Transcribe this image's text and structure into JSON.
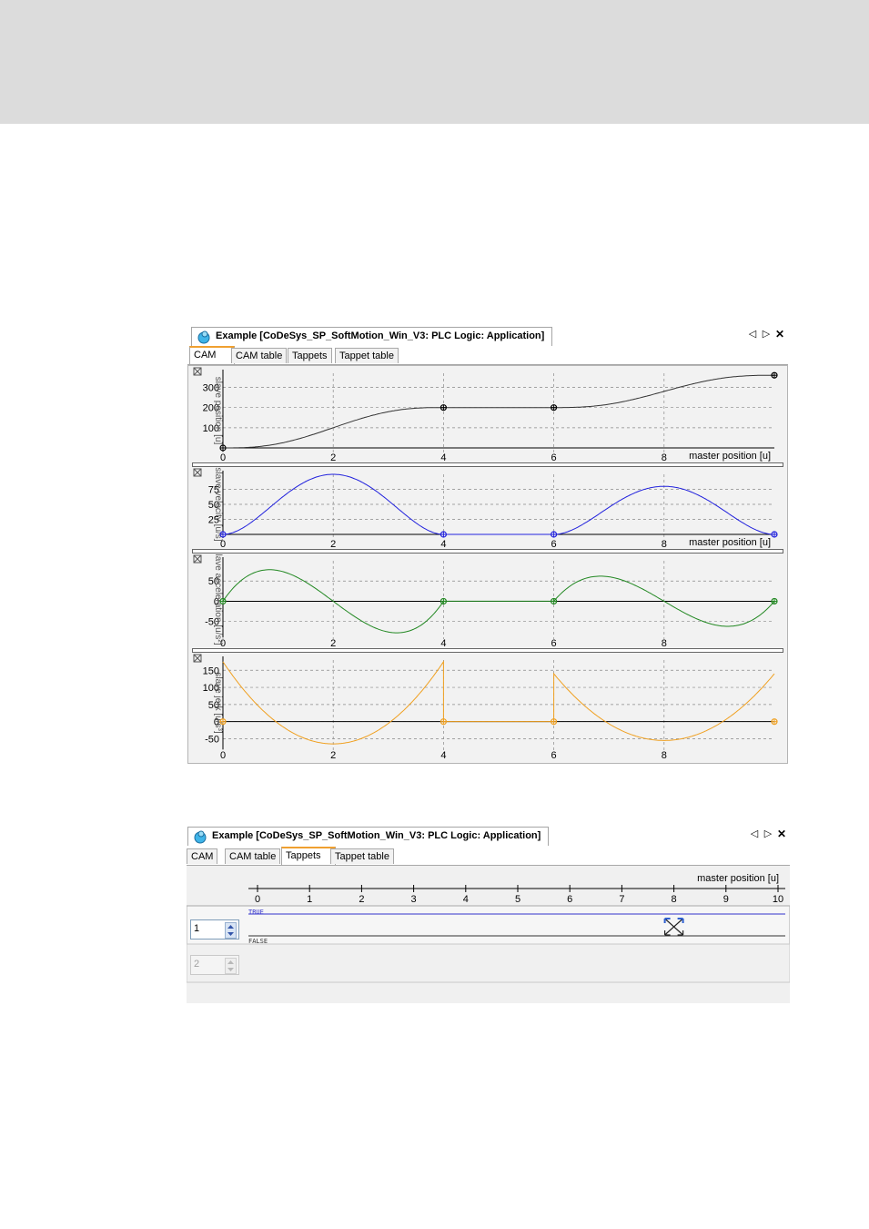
{
  "window1": {
    "title": "Example [CoDeSys_SP_SoftMotion_Win_V3: PLC Logic: Application]",
    "tabs": [
      "CAM",
      "CAM table",
      "Tappets",
      "Tappet table"
    ],
    "active_tab": "CAM",
    "controls": {
      "left": "◁",
      "right": "▷",
      "close": "✕"
    }
  },
  "window2": {
    "title": "Example [CoDeSys_SP_SoftMotion_Win_V3: PLC Logic: Application]",
    "tabs": [
      "CAM",
      "CAM table",
      "Tappets",
      "Tappet table"
    ],
    "active_tab": "Tappets",
    "controls": {
      "left": "◁",
      "right": "▷",
      "close": "✕"
    },
    "axis_label": "master position [u]",
    "axis_ticks": [
      "0",
      "1",
      "2",
      "3",
      "4",
      "5",
      "6",
      "7",
      "8",
      "9",
      "10"
    ],
    "true_label": "TRUE",
    "false_label": "FALSE",
    "tappet_1": "1",
    "tappet_2": "2",
    "colors": {
      "true_line": "#3333cc",
      "marker": "#3060d0"
    }
  },
  "chart_data": [
    {
      "type": "line",
      "ylabel": "slave position [u]",
      "xlabel": "master position [u]",
      "xlim": [
        0,
        10
      ],
      "ylim": [
        0,
        370
      ],
      "x_ticks": [
        "0",
        "2",
        "4",
        "6",
        "8"
      ],
      "y_ticks": [
        "100",
        "200",
        "300"
      ],
      "color": "#333333",
      "series": [
        {
          "x": [
            0,
            4,
            6,
            10
          ],
          "y": [
            0,
            200,
            200,
            360
          ]
        }
      ]
    },
    {
      "type": "line",
      "ylabel": "slave velocity [u/s]",
      "xlabel": "master position [u]",
      "xlim": [
        0,
        10
      ],
      "ylim": [
        0,
        100
      ],
      "x_ticks": [
        "0",
        "2",
        "4",
        "6",
        "8"
      ],
      "y_ticks": [
        "25",
        "50",
        "75"
      ],
      "color": "#2222dd",
      "series": [
        {
          "x": [
            0,
            2,
            4,
            6,
            8,
            10
          ],
          "y": [
            0,
            100,
            0,
            0,
            80,
            0
          ]
        }
      ]
    },
    {
      "type": "line",
      "ylabel": "slave acceleration [u/s²]",
      "xlim": [
        0,
        10
      ],
      "ylim": [
        -80,
        100
      ],
      "x_ticks": [
        "0",
        "2",
        "4",
        "6",
        "8"
      ],
      "y_ticks": [
        "-50",
        "0",
        "50"
      ],
      "color": "#228822",
      "series": [
        {
          "x": [
            0,
            0.9,
            3.2,
            4,
            6,
            6.9,
            9.1,
            10
          ],
          "y": [
            0,
            78,
            -78,
            0,
            0,
            62,
            -62,
            0
          ]
        }
      ]
    },
    {
      "type": "line",
      "ylabel": "slave jerk [u/s³]",
      "xlim": [
        0,
        10
      ],
      "ylim": [
        -70,
        180
      ],
      "x_ticks": [
        "0",
        "2",
        "4",
        "6",
        "8"
      ],
      "y_ticks": [
        "-50",
        "0",
        "50",
        "100",
        "150"
      ],
      "color": "#f0a020",
      "series": [
        {
          "x": [
            0,
            2,
            4,
            4,
            6,
            6,
            8,
            10
          ],
          "y": [
            175,
            -65,
            175,
            0,
            0,
            140,
            -55,
            140
          ]
        }
      ]
    }
  ]
}
